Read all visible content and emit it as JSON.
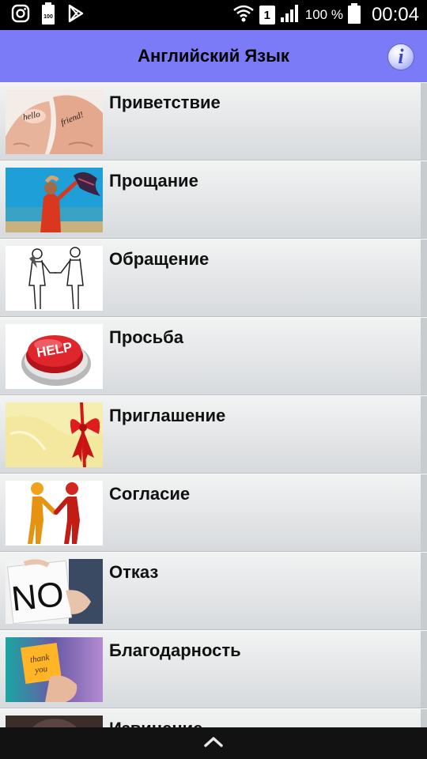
{
  "status_bar": {
    "icons": [
      "instagram-icon",
      "battery-100-icon",
      "play-store-icon",
      "wifi-icon",
      "sim-1-icon",
      "signal-icon",
      "battery-icon"
    ],
    "sim_label": "1",
    "battery_small_label": "100",
    "battery_percent": "100 %",
    "time": "00:04"
  },
  "app_bar": {
    "title": "Английский Язык",
    "info_label": "i"
  },
  "list": {
    "items": [
      {
        "label": "Приветствие",
        "thumb": "hello-friend-hands"
      },
      {
        "label": "Прощание",
        "thumb": "waving-scarf-beach"
      },
      {
        "label": "Обращение",
        "thumb": "handshake-sketch"
      },
      {
        "label": "Просьба",
        "thumb": "help-button"
      },
      {
        "label": "Приглашение",
        "thumb": "red-bow"
      },
      {
        "label": "Согласие",
        "thumb": "figures-handshake"
      },
      {
        "label": "Отказ",
        "thumb": "no-sign"
      },
      {
        "label": "Благодарность",
        "thumb": "thank-you-note"
      },
      {
        "label": "Извинение",
        "thumb": "apology"
      }
    ]
  },
  "colors": {
    "app_bar": "#7b7bf7",
    "row_top": "#f2f3f3",
    "row_bottom": "#d7dadd"
  }
}
